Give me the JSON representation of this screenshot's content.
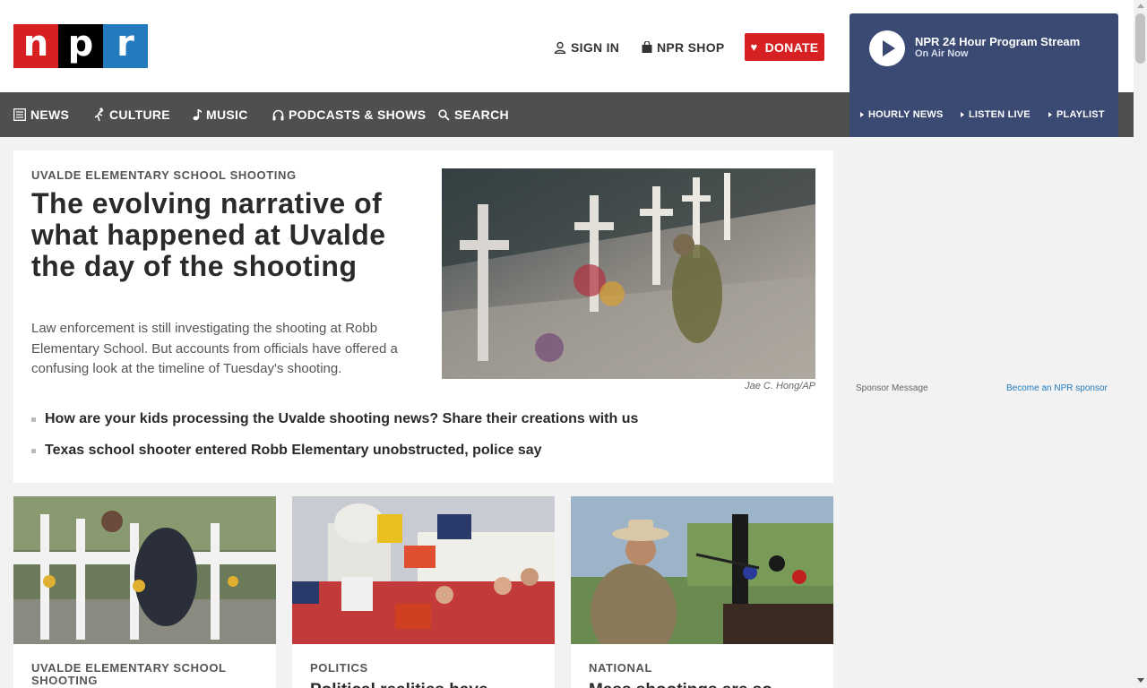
{
  "header": {
    "logo_letters": [
      "n",
      "p",
      "r"
    ],
    "sign_in": "SIGN IN",
    "shop": "NPR SHOP",
    "donate": "DONATE"
  },
  "player": {
    "title": "NPR 24 Hour Program Stream",
    "subtitle": "On Air Now"
  },
  "nav": {
    "items": [
      {
        "label": "NEWS",
        "icon": "news-icon"
      },
      {
        "label": "CULTURE",
        "icon": "culture-icon"
      },
      {
        "label": "MUSIC",
        "icon": "music-note-icon"
      },
      {
        "label": "PODCASTS & SHOWS",
        "icon": "headphones-icon"
      },
      {
        "label": "SEARCH",
        "icon": "search-icon"
      }
    ],
    "right": [
      {
        "label": "HOURLY NEWS"
      },
      {
        "label": "LISTEN LIVE"
      },
      {
        "label": "PLAYLIST"
      }
    ]
  },
  "featured": {
    "eyebrow": "UVALDE ELEMENTARY SCHOOL SHOOTING",
    "title": "The evolving narrative of what happened at Uvalde the day of the shooting",
    "teaser": "Law enforcement is still investigating the shooting at Robb Elementary School. But accounts from officials have offered a confusing look at the timeline of Tuesday's shooting.",
    "credit": "Jae C. Hong/AP",
    "related": [
      "How are your kids processing the Uvalde shooting news? Share their creations with us",
      "Texas school shooter entered Robb Elementary unobstructed, police say"
    ]
  },
  "sponsor": {
    "label": "Sponsor Message",
    "link": "Become an NPR sponsor"
  },
  "cards": [
    {
      "eyebrow": "UVALDE ELEMENTARY SCHOOL SHOOTING",
      "title": ""
    },
    {
      "eyebrow": "POLITICS",
      "title": "Political realities have"
    },
    {
      "eyebrow": "NATIONAL",
      "title": "Mass shootings are so"
    }
  ],
  "colors": {
    "npr_red": "#d62021",
    "npr_blue": "#237bbd",
    "player_bg": "#3a4a73",
    "nav_bg": "#4f4f4f"
  }
}
